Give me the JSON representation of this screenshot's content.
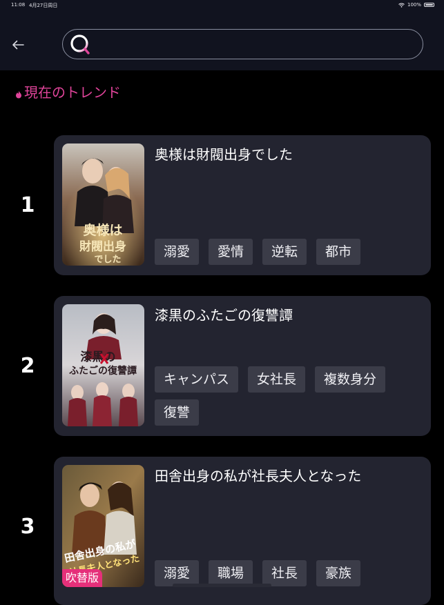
{
  "status_bar": {
    "time": "11:08",
    "date": "4月27日周日",
    "battery": "100%"
  },
  "search": {
    "placeholder": "",
    "value": ""
  },
  "section": {
    "title": "現在のトレンド"
  },
  "items": [
    {
      "rank": "1",
      "title": "奥様は財閥出身でした",
      "poster_text": "奥様は財閥出身でした",
      "tags": [
        "溺愛",
        "愛情",
        "逆転",
        "都市"
      ],
      "badge": ""
    },
    {
      "rank": "2",
      "title": "漆黒のふたごの復讐譚",
      "poster_text": "漆黒のふたごの復讐譚",
      "tags": [
        "キャンパス",
        "女社長",
        "複数身分",
        "復讐"
      ],
      "badge": ""
    },
    {
      "rank": "3",
      "title": "田舎出身の私が社長夫人となった",
      "poster_text": "田舎出身の私が社長夫人となった",
      "tags": [
        "溺愛",
        "職場",
        "社長",
        "豪族"
      ],
      "badge": "吹替版"
    }
  ],
  "colors": {
    "accent": "#e0449a",
    "card_bg": "#232430",
    "tag_bg": "#3b3c48",
    "header_bg": "#11131f",
    "badge_bg": "#e5307a"
  },
  "icons": {
    "back": "arrow-left-icon",
    "search": "search-icon",
    "section": "flame-icon",
    "wifi": "wifi-icon",
    "battery": "battery-icon"
  }
}
